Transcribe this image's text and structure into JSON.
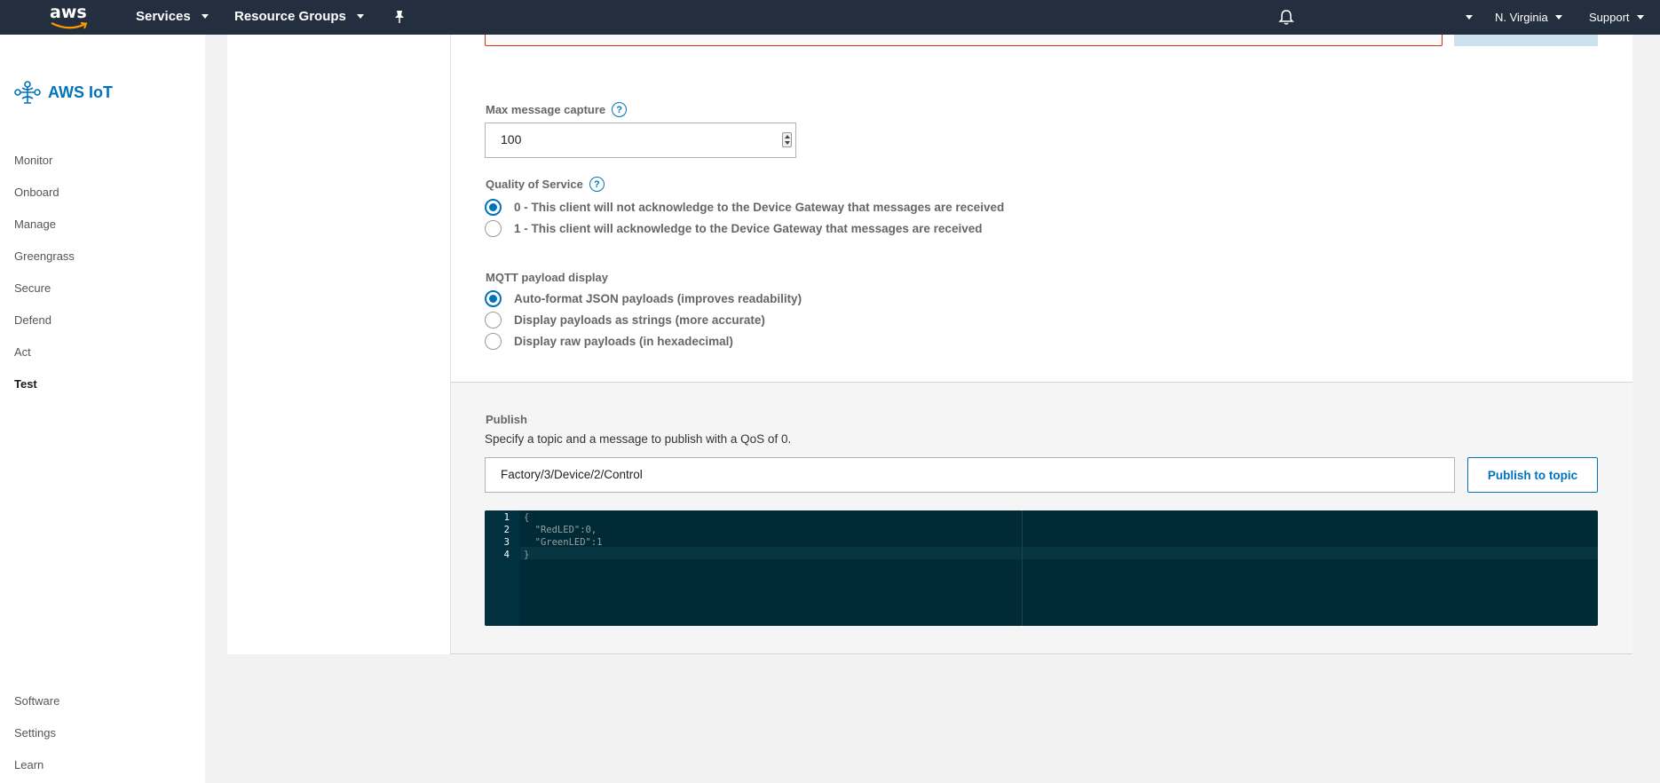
{
  "topnav": {
    "logo": "aws",
    "services": "Services",
    "resource_groups": "Resource Groups",
    "region": "N. Virginia",
    "support": "Support",
    "icons": [
      "pin-icon",
      "bell-icon"
    ]
  },
  "sidebar": {
    "brand": "AWS IoT",
    "items": [
      {
        "label": "Monitor"
      },
      {
        "label": "Onboard"
      },
      {
        "label": "Manage"
      },
      {
        "label": "Greengrass"
      },
      {
        "label": "Secure"
      },
      {
        "label": "Defend"
      },
      {
        "label": "Act"
      },
      {
        "label": "Test"
      }
    ],
    "bottom_items": [
      {
        "label": "Software"
      },
      {
        "label": "Settings"
      },
      {
        "label": "Learn"
      }
    ],
    "active": "Test"
  },
  "subscribe": {
    "max_capture_label": "Max message capture",
    "max_capture_value": "100",
    "qos_label": "Quality of Service",
    "qos_options": [
      {
        "label": "0 - This client will not acknowledge to the Device Gateway that messages are received",
        "checked": true
      },
      {
        "label": "1 - This client will acknowledge to the Device Gateway that messages are received",
        "checked": false
      }
    ],
    "payload_label": "MQTT payload display",
    "payload_options": [
      {
        "label": "Auto-format JSON payloads (improves readability)",
        "checked": true
      },
      {
        "label": "Display payloads as strings (more accurate)",
        "checked": false
      },
      {
        "label": "Display raw payloads (in hexadecimal)",
        "checked": false
      }
    ]
  },
  "publish": {
    "title": "Publish",
    "description": "Specify a topic and a message to publish with a QoS of 0.",
    "topic_value": "Factory/3/Device/2/Control",
    "button": "Publish to topic",
    "editor": {
      "line_numbers": [
        "1",
        "2",
        "3",
        "4"
      ],
      "lines": [
        "{",
        "  \"RedLED\":0,",
        "  \"GreenLED\":1",
        "}"
      ]
    }
  },
  "colors": {
    "nav_bg": "#232f3e",
    "accent": "#0073bb",
    "editor_bg": "#002b36"
  }
}
